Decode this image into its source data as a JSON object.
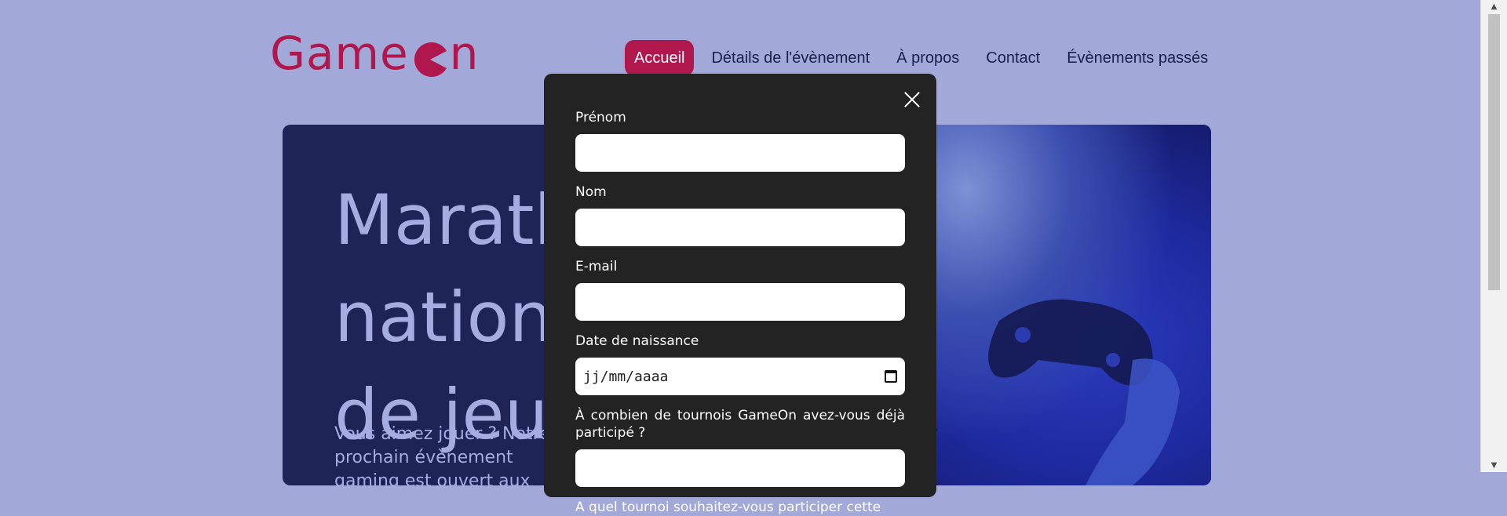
{
  "header": {
    "logo_text_a": "Game",
    "logo_text_b": "n",
    "nav": [
      {
        "label": "Accueil",
        "active": true
      },
      {
        "label": "Détails de l'évènement",
        "active": false
      },
      {
        "label": "À propos",
        "active": false
      },
      {
        "label": "Contact",
        "active": false
      },
      {
        "label": "Évènements passés",
        "active": false
      }
    ]
  },
  "hero": {
    "title_line1": "Marathon national",
    "title_line2": "de jeux vidéos",
    "text": "Vous aimez jouer ? Notre prochain évènement gaming est ouvert aux réservations... Places limitées !"
  },
  "modal": {
    "fields": [
      {
        "label": "Prénom",
        "value": ""
      },
      {
        "label": "Nom",
        "value": ""
      },
      {
        "label": "E-mail",
        "value": ""
      },
      {
        "label": "Date de naissance",
        "placeholder": "jj/mm/aaaa"
      },
      {
        "label": "À combien de tournois GameOn avez-vous déjà participé ?",
        "value": ""
      },
      {
        "label": "A quel tournoi souhaitez-vous participer cette année ?"
      }
    ]
  },
  "colors": {
    "brand": "#b0174c",
    "background": "#a2a9d9",
    "modal": "#232323",
    "hero": "#1f2456"
  }
}
